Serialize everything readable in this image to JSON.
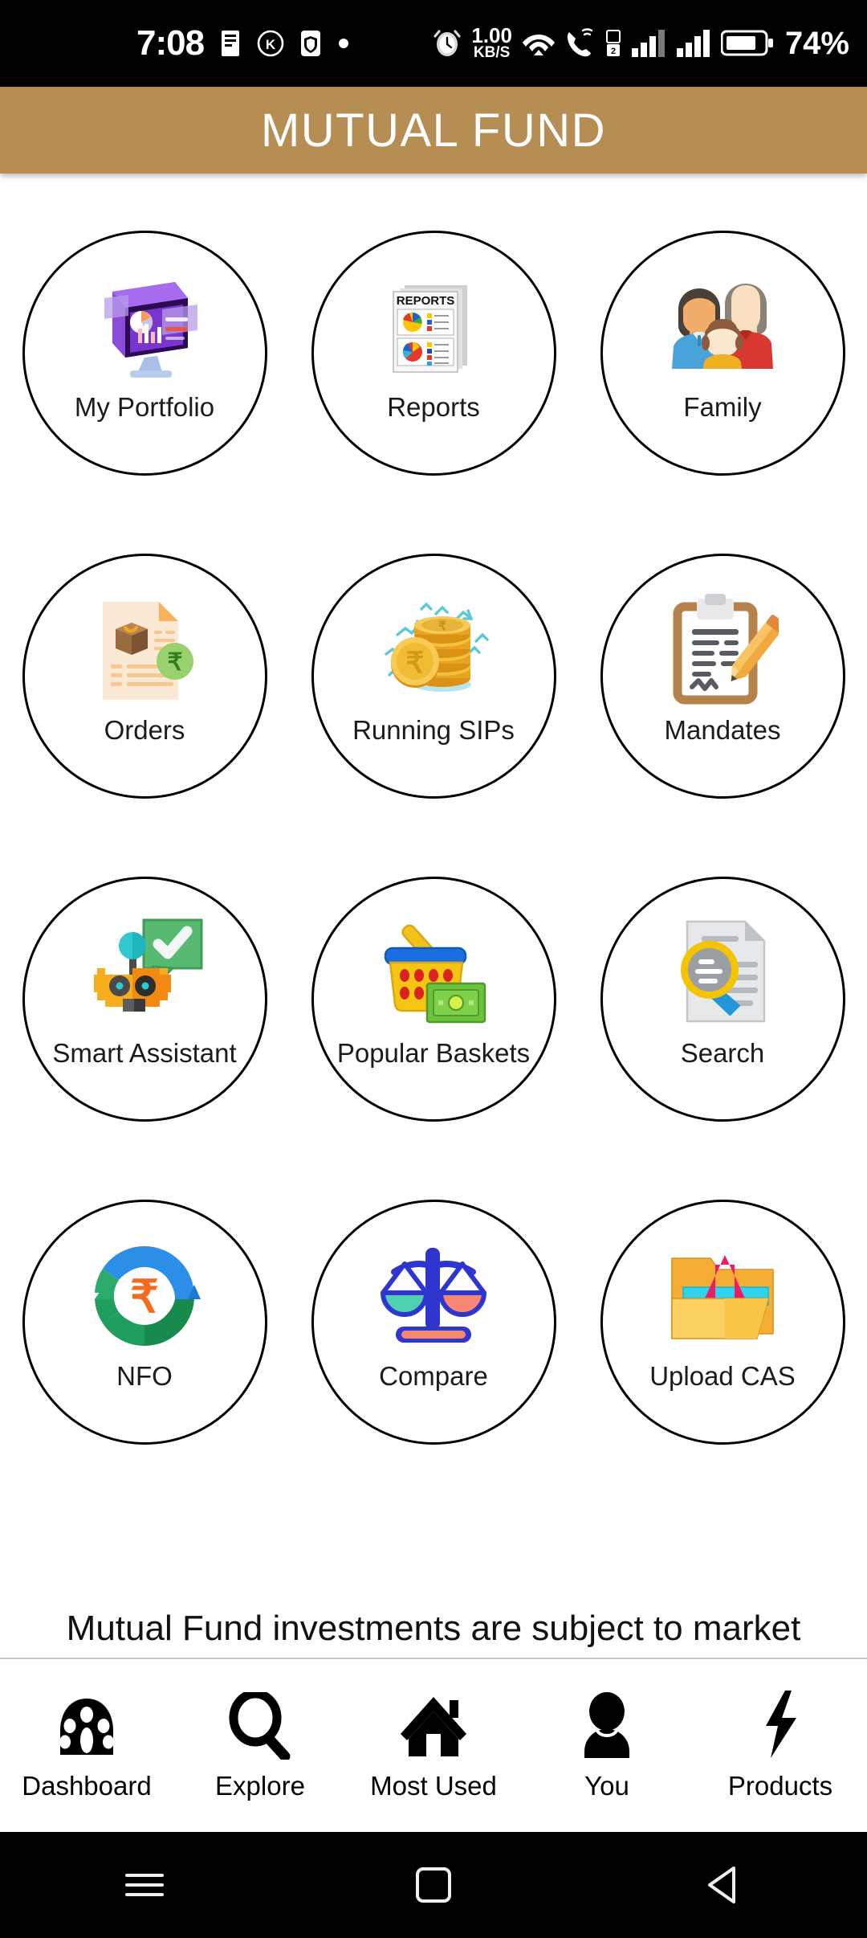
{
  "status_bar": {
    "time": "7:08",
    "icons_left": [
      "message-icon",
      "k-badge-icon",
      "shield-icon",
      "dot-icon"
    ],
    "network_speed_value": "1.00",
    "network_speed_unit": "KB/S",
    "icons_right": [
      "alarm-icon",
      "wifi-icon",
      "call-wifi-icon",
      "sim1-signal-icon",
      "sim2-signal-icon",
      "battery-icon"
    ],
    "battery_percent": "74%"
  },
  "header": {
    "title": "MUTUAL FUND",
    "background_color": "#b68d53",
    "text_color": "#ffffff"
  },
  "grid": {
    "tiles": [
      {
        "label": "My Portfolio",
        "icon": "monitor-dashboard-icon"
      },
      {
        "label": "Reports",
        "icon": "report-documents-icon"
      },
      {
        "label": "Family",
        "icon": "family-icon"
      },
      {
        "label": "Orders",
        "icon": "order-document-rupee-icon"
      },
      {
        "label": "Running SIPs",
        "icon": "coin-stack-rupee-icon"
      },
      {
        "label": "Mandates",
        "icon": "clipboard-pencil-icon"
      },
      {
        "label": "Smart Assistant",
        "icon": "robot-check-icon"
      },
      {
        "label": "Popular Baskets",
        "icon": "basket-money-icon"
      },
      {
        "label": "Search",
        "icon": "document-magnifier-icon"
      },
      {
        "label": "NFO",
        "icon": "circular-arrows-rupee-icon"
      },
      {
        "label": "Compare",
        "icon": "balance-scale-icon"
      },
      {
        "label": "Upload CAS",
        "icon": "folder-upload-icon"
      }
    ]
  },
  "disclaimer": {
    "text": "Mutual Fund investments are subject to market"
  },
  "bottom_nav": {
    "items": [
      {
        "label": "Dashboard",
        "icon": "speedometer-icon"
      },
      {
        "label": "Explore",
        "icon": "search-icon"
      },
      {
        "label": "Most Used",
        "icon": "home-icon"
      },
      {
        "label": "You",
        "icon": "person-icon"
      },
      {
        "label": "Products",
        "icon": "lightning-bolt-icon"
      }
    ]
  },
  "system_nav": {
    "buttons": [
      {
        "icon": "menu-recents-icon"
      },
      {
        "icon": "home-square-icon"
      },
      {
        "icon": "back-triangle-icon"
      }
    ]
  }
}
